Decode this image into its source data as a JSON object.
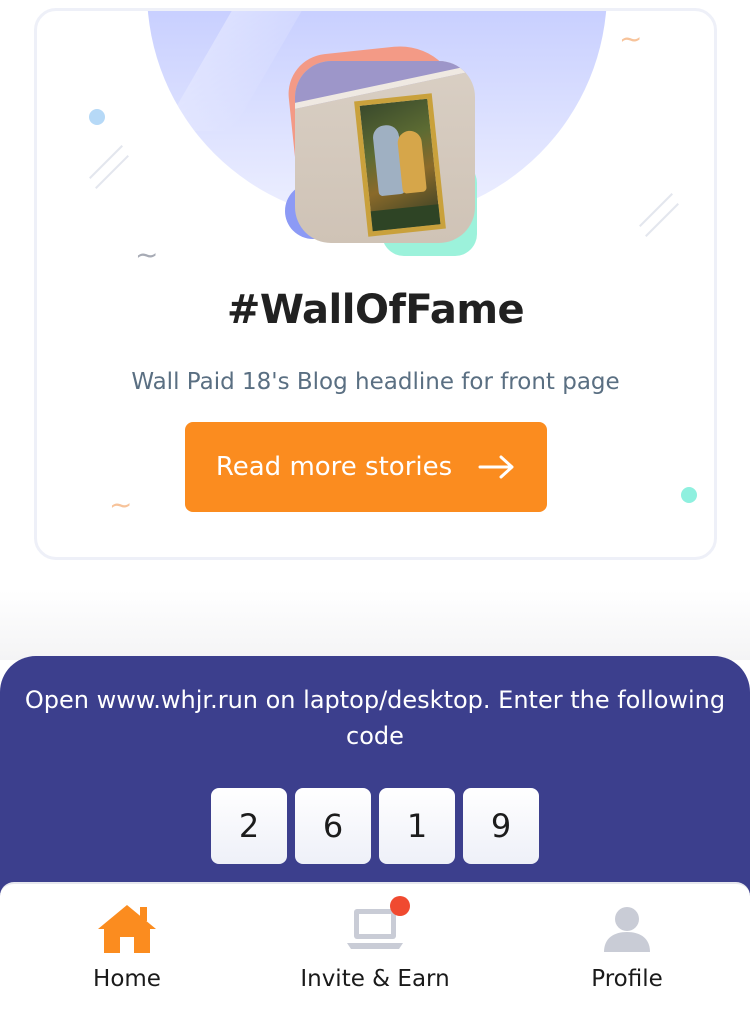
{
  "wall_of_fame": {
    "title": "#WallOfFame",
    "subtitle": "Wall Paid 18's Blog headline for front page",
    "button_label": "Read more stories",
    "button_icon": "arrow-right-icon",
    "accent_color": "#fb8c1f"
  },
  "code_panel": {
    "instruction": "Open www.whjr.run on laptop/desktop. Enter the following code",
    "digits": [
      "2",
      "6",
      "1",
      "9"
    ],
    "background_color": "#3c3f8d"
  },
  "bottom_nav": {
    "items": [
      {
        "label": "Home",
        "icon": "home-icon",
        "active": true,
        "color": "#fb8c1f"
      },
      {
        "label": "Invite & Earn",
        "icon": "laptop-icon",
        "badge": true,
        "color": "#c9ccd6"
      },
      {
        "label": "Profile",
        "icon": "user-icon",
        "color": "#c9ccd6"
      }
    ]
  }
}
